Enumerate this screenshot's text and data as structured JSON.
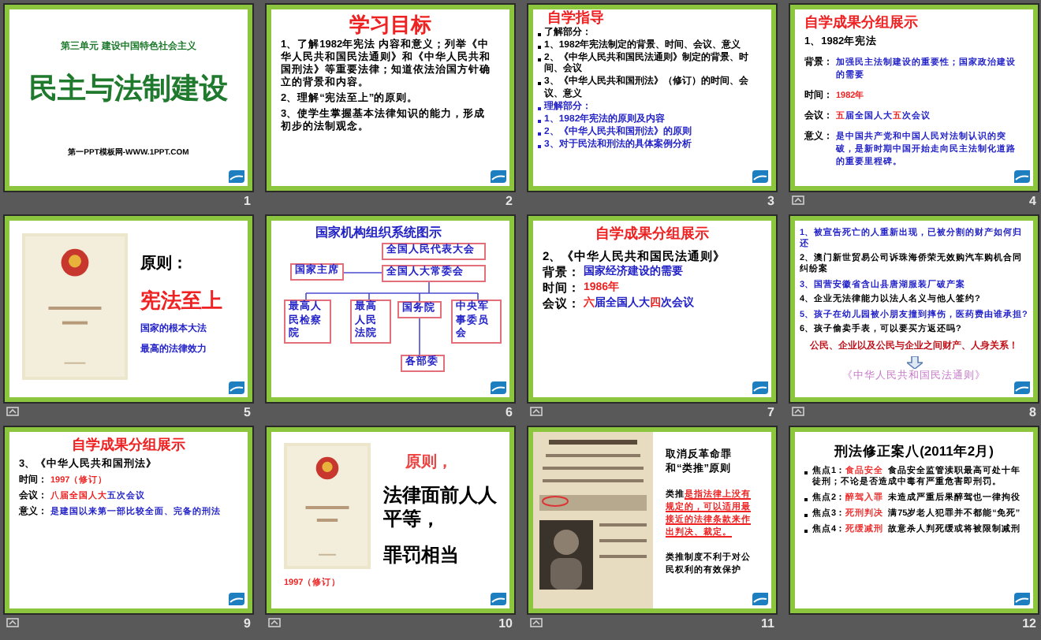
{
  "slides": [
    {
      "number": "1",
      "kind": "title",
      "animated": false,
      "unit": "第三单元  建设中国特色社会主义",
      "title": "民主与法制建设",
      "footer": "第一PPT模板网-WWW.1PPT.COM"
    },
    {
      "number": "2",
      "kind": "objectives",
      "animated": false,
      "heading": "学习目标",
      "items": [
        "1、了解1982年宪法 内容和意义；列举《中华人民共和国民法通则》和《中华人民共和国刑法》等重要法律；知道依法治国方针确立的背景和内容。",
        "2、理解“宪法至上”的原则。",
        "3、使学生掌握基本法律知识的能力，形成初步的法制观念。"
      ]
    },
    {
      "number": "3",
      "kind": "outline",
      "animated": false,
      "heading": "自学指导",
      "items": [
        {
          "text": "了解部分：",
          "highlight": false
        },
        {
          "text": "1、1982年宪法制定的背景、时间、会议、意义",
          "highlight": false
        },
        {
          "text": "2、《中华人民共和国民法通则》制定的背景、时间、会议",
          "highlight": false
        },
        {
          "text": "3、《中华人民共和国刑法》（修订）的时间、会议、意义",
          "highlight": false
        },
        {
          "text": "理解部分：",
          "highlight": true
        },
        {
          "text": "1、1982年宪法的原则及内容",
          "highlight": true
        },
        {
          "text": "2、《中华人民共和国刑法》的原则",
          "highlight": true
        },
        {
          "text": "3、对于民法和刑法的具体案例分析",
          "highlight": true
        }
      ]
    },
    {
      "number": "4",
      "kind": "fields",
      "animated": true,
      "heading": "自学成果分组展示",
      "subheading": "1、1982年宪法",
      "rows": [
        {
          "label": "背景：",
          "parts": [
            {
              "text": "加强民主法制建设的重要性；国家政治建设的需要",
              "highlight": false
            }
          ]
        },
        {
          "label": "时间：",
          "parts": [
            {
              "text": "1982年",
              "highlight": true
            }
          ]
        },
        {
          "label": "会议：",
          "parts": [
            {
              "text": "五",
              "highlight": true
            },
            {
              "text": "届全国人大",
              "highlight": false
            },
            {
              "text": "五",
              "highlight": true
            },
            {
              "text": "次会议",
              "highlight": false
            }
          ]
        },
        {
          "label": "意义：",
          "parts": [
            {
              "text": "是中国共产党和中国人民对法制认识的突破，是新时期中国开始走向民主法制化道路的重要里程碑。",
              "highlight": false
            }
          ]
        }
      ]
    },
    {
      "number": "5",
      "kind": "principle",
      "animated": true,
      "heading": "原则：",
      "motto": "宪法至上",
      "lines": [
        "国家的根本大法",
        "最高的法律效力"
      ]
    },
    {
      "number": "6",
      "kind": "org_chart",
      "animated": false,
      "heading": "国家机构组织系统图示",
      "nodes": [
        "全国人民代表大会",
        "国家主席",
        "全国人大常委会",
        "最高人民检察院",
        "最高人民法院",
        "国务院",
        "中央军事委员会",
        "各部委"
      ]
    },
    {
      "number": "7",
      "kind": "fields",
      "animated": true,
      "heading": "自学成果分组展示",
      "subheading": "2、《中华人民共和国民法通则》",
      "rows": [
        {
          "label": "背景：",
          "parts": [
            {
              "text": "国家经济建设的需要",
              "highlight": false
            }
          ]
        },
        {
          "label": "时间：",
          "parts": [
            {
              "text": "1986年",
              "highlight": true
            }
          ]
        },
        {
          "label": "会议：",
          "parts": [
            {
              "text": "六",
              "highlight": true
            },
            {
              "text": "届全国人大",
              "highlight": false
            },
            {
              "text": "四",
              "highlight": true
            },
            {
              "text": "次会议",
              "highlight": false
            }
          ]
        }
      ]
    },
    {
      "number": "8",
      "kind": "cases",
      "animated": true,
      "items": [
        {
          "text": "1、被宣告死亡的人重新出现，已被分割的财产如何归还",
          "highlight": true
        },
        {
          "text": "2、澳门新世贸易公司诉珠海侨荣无效购汽车购机合同纠纷案",
          "highlight": false
        },
        {
          "text": "3、国营安徽省含山县唐湖服装厂破产案",
          "highlight": true
        },
        {
          "text": "4、企业无法律能力以法人名义与他人签约?",
          "highlight": false
        },
        {
          "text": "5、孩子在幼儿园被小朋友撞到摔伤，医药费由谁承担?",
          "highlight": true
        },
        {
          "text": "6、孩子偷卖手表，可以要买方返还吗?",
          "highlight": false
        }
      ],
      "slogan": "公民、企业以及公民与企业之间财产、人身关系！",
      "footer": "《中华人民共和国民法通则》"
    },
    {
      "number": "9",
      "kind": "fields",
      "animated": true,
      "heading": "自学成果分组展示",
      "subheading": "3、《中华人民共和国刑法》",
      "rows": [
        {
          "label": "时间：",
          "parts": [
            {
              "text": "1997（修订）",
              "highlight": true
            }
          ]
        },
        {
          "label": "会议：",
          "parts": [
            {
              "text": "八届全国人大",
              "highlight": true
            },
            {
              "text": "五次会议",
              "highlight": false
            }
          ]
        },
        {
          "label": "意义：",
          "parts": [
            {
              "text": "是建国以来第一部比较全面、完备的刑法",
              "highlight": false
            }
          ]
        }
      ]
    },
    {
      "number": "10",
      "kind": "equality",
      "animated": true,
      "heading": "原则，",
      "lines": [
        "法律面前人人平等，",
        "罪罚相当"
      ],
      "note": "1997（修订）"
    },
    {
      "number": "11",
      "kind": "picture_text",
      "animated": true,
      "heading": "取消反革命罪和“类推”原则",
      "parts": [
        {
          "text": "类推",
          "highlight": false
        },
        {
          "text": "是指法律上没有规定的，可以适用最接近的法律条款来作出判决、裁定。",
          "highlight": true
        }
      ],
      "note": "类推制度不利于对公民权利的有效保护"
    },
    {
      "number": "12",
      "kind": "focus",
      "animated": false,
      "heading": "刑法修正案八(2011年2月)",
      "items": [
        {
          "label": "焦点1：",
          "tag": "食品安全",
          "text": "食品安全监管渎职最高可处十年徒刑；不论是否造成中毒有严重危害即刑罚。"
        },
        {
          "label": "焦点2：",
          "tag": "醉驾入罪",
          "text": "未造成严重后果醉驾也一律拘役"
        },
        {
          "label": "焦点3：",
          "tag": "死刑判决",
          "text": "满75岁老人犯罪并不都能“免死”"
        },
        {
          "label": "焦点4：",
          "tag": "死缓减刑",
          "text": "故意杀人判死缓或将被限制减刑"
        }
      ]
    }
  ]
}
